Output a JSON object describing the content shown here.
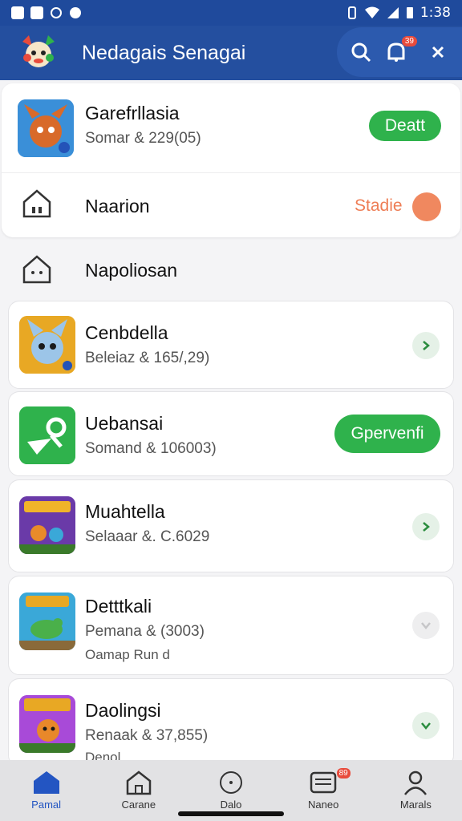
{
  "status_bar": {
    "time": "1:38"
  },
  "header": {
    "title": "Nedagais Senagai",
    "notification_badge": "39"
  },
  "featured": {
    "title": "Garefrllasia",
    "subtitle": "Somar & 229(05)",
    "button": "Deatt"
  },
  "section1": {
    "label": "Naarion",
    "action": "Stadie"
  },
  "section2": {
    "label": "Napoliosan"
  },
  "apps": [
    {
      "title": "Cenbdella",
      "subtitle": "Beleiaz & 165/,29)"
    },
    {
      "title": "Uebansai",
      "subtitle": "Somand & 106003)",
      "button": "Gpervenfi"
    },
    {
      "title": "Muahtella",
      "subtitle": "Selaaar &. C.6029"
    },
    {
      "title": "Detttkali",
      "subtitle": "Pemana &  (3003)",
      "extra": "Oamap Run d"
    },
    {
      "title": "Daolingsi",
      "subtitle": "Renaak & 37,855)",
      "extra": "Denol"
    }
  ],
  "nav": {
    "items": [
      {
        "label": "Pamal"
      },
      {
        "label": "Carane"
      },
      {
        "label": "Dalo"
      },
      {
        "label": "Naneo",
        "badge": "89"
      },
      {
        "label": "Marals"
      }
    ]
  },
  "colors": {
    "primary": "#244f9f",
    "accent_green": "#2fb24c",
    "accent_orange": "#ee7d55"
  }
}
